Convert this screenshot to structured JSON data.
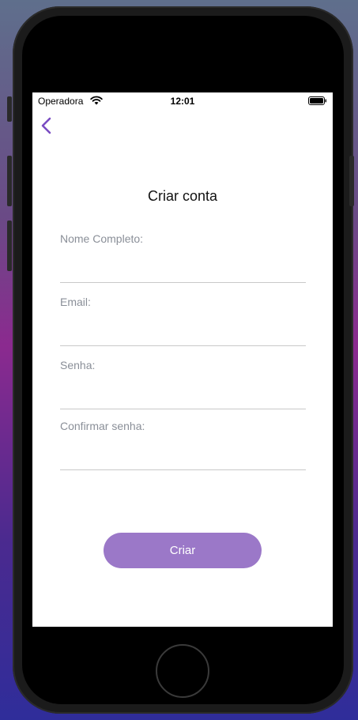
{
  "status_bar": {
    "carrier": "Operadora",
    "time": "12:01"
  },
  "page": {
    "title": "Criar conta"
  },
  "form": {
    "fields": [
      {
        "label": "Nome Completo:",
        "value": ""
      },
      {
        "label": "Email:",
        "value": ""
      },
      {
        "label": "Senha:",
        "value": ""
      },
      {
        "label": "Confirmar senha:",
        "value": ""
      }
    ],
    "submit_label": "Criar"
  },
  "colors": {
    "accent": "#9b78c8",
    "back_icon": "#7a4cc2",
    "label": "#8a8f98",
    "underline": "#c9c9c9"
  },
  "icons": {
    "back": "chevron-left-icon",
    "wifi": "wifi-icon",
    "battery": "battery-icon"
  }
}
